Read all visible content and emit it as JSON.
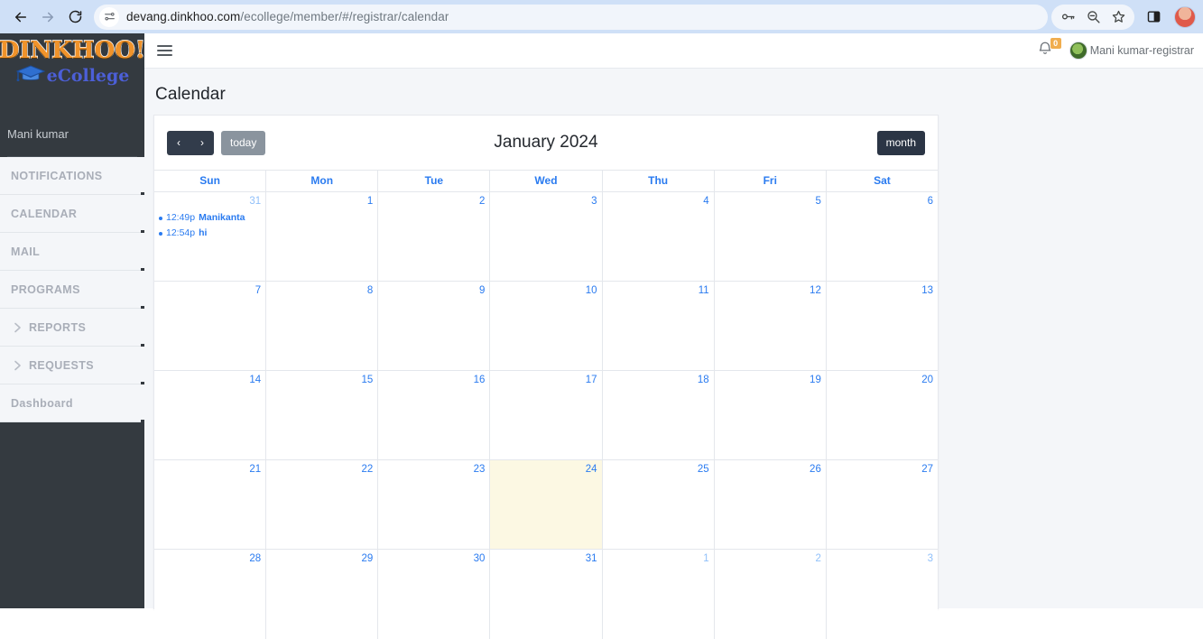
{
  "browser": {
    "url_main": "devang.dinkhoo.com",
    "url_path": "/ecollege/member/#/registrar/calendar",
    "back_icon": "back-arrow-icon",
    "forward_icon": "forward-arrow-icon",
    "reload_icon": "reload-icon",
    "site_info_icon": "site-settings-icon",
    "password_icon": "password-key-icon",
    "zoom_icon": "zoom-out-icon",
    "bookmark_icon": "bookmark-star-icon",
    "sidepanel_icon": "side-panel-icon",
    "profile_icon": "browser-profile-avatar"
  },
  "sidebar": {
    "logo_word": "DINKHOO!",
    "logo_sub": "eCollege",
    "user_name": "Mani kumar",
    "items": [
      {
        "label": "NOTIFICATIONS",
        "expandable": false
      },
      {
        "label": "CALENDAR",
        "expandable": false
      },
      {
        "label": "MAIL",
        "expandable": false
      },
      {
        "label": "PROGRAMS",
        "expandable": false
      },
      {
        "label": "REPORTS",
        "expandable": true
      },
      {
        "label": "REQUESTS",
        "expandable": true
      },
      {
        "label": "Dashboard",
        "expandable": false
      }
    ]
  },
  "topbar": {
    "menu_toggle": "hamburger-menu-icon",
    "bell_icon": "notification-bell-icon",
    "bell_badge": "0",
    "user_label": "Mani kumar-registrar"
  },
  "page": {
    "title": "Calendar"
  },
  "calendar": {
    "title": "January 2024",
    "prev_label": "‹",
    "next_label": "›",
    "today_label": "today",
    "view_label": "month",
    "weekdays": [
      "Sun",
      "Mon",
      "Tue",
      "Wed",
      "Thu",
      "Fri",
      "Sat"
    ],
    "today_date": 24,
    "weeks": [
      [
        {
          "day": "31",
          "other": true,
          "today": false,
          "events": [
            {
              "time": "12:49p",
              "title": "Manikanta"
            },
            {
              "time": "12:54p",
              "title": "hi"
            }
          ]
        },
        {
          "day": "1",
          "other": false,
          "today": false,
          "events": []
        },
        {
          "day": "2",
          "other": false,
          "today": false,
          "events": []
        },
        {
          "day": "3",
          "other": false,
          "today": false,
          "events": []
        },
        {
          "day": "4",
          "other": false,
          "today": false,
          "events": []
        },
        {
          "day": "5",
          "other": false,
          "today": false,
          "events": []
        },
        {
          "day": "6",
          "other": false,
          "today": false,
          "events": []
        }
      ],
      [
        {
          "day": "7",
          "other": false,
          "today": false,
          "events": []
        },
        {
          "day": "8",
          "other": false,
          "today": false,
          "events": []
        },
        {
          "day": "9",
          "other": false,
          "today": false,
          "events": []
        },
        {
          "day": "10",
          "other": false,
          "today": false,
          "events": []
        },
        {
          "day": "11",
          "other": false,
          "today": false,
          "events": []
        },
        {
          "day": "12",
          "other": false,
          "today": false,
          "events": []
        },
        {
          "day": "13",
          "other": false,
          "today": false,
          "events": []
        }
      ],
      [
        {
          "day": "14",
          "other": false,
          "today": false,
          "events": []
        },
        {
          "day": "15",
          "other": false,
          "today": false,
          "events": []
        },
        {
          "day": "16",
          "other": false,
          "today": false,
          "events": []
        },
        {
          "day": "17",
          "other": false,
          "today": false,
          "events": []
        },
        {
          "day": "18",
          "other": false,
          "today": false,
          "events": []
        },
        {
          "day": "19",
          "other": false,
          "today": false,
          "events": []
        },
        {
          "day": "20",
          "other": false,
          "today": false,
          "events": []
        }
      ],
      [
        {
          "day": "21",
          "other": false,
          "today": false,
          "events": []
        },
        {
          "day": "22",
          "other": false,
          "today": false,
          "events": []
        },
        {
          "day": "23",
          "other": false,
          "today": false,
          "events": []
        },
        {
          "day": "24",
          "other": false,
          "today": true,
          "events": []
        },
        {
          "day": "25",
          "other": false,
          "today": false,
          "events": []
        },
        {
          "day": "26",
          "other": false,
          "today": false,
          "events": []
        },
        {
          "day": "27",
          "other": false,
          "today": false,
          "events": []
        }
      ],
      [
        {
          "day": "28",
          "other": false,
          "today": false,
          "events": []
        },
        {
          "day": "29",
          "other": false,
          "today": false,
          "events": []
        },
        {
          "day": "30",
          "other": false,
          "today": false,
          "events": []
        },
        {
          "day": "31",
          "other": false,
          "today": false,
          "events": []
        },
        {
          "day": "1",
          "other": true,
          "today": false,
          "events": []
        },
        {
          "day": "2",
          "other": true,
          "today": false,
          "events": []
        },
        {
          "day": "3",
          "other": true,
          "today": false,
          "events": []
        }
      ]
    ]
  },
  "colors": {
    "sidebar_dark": "#343a40",
    "accent_blue": "#2a7bf0",
    "today_bg": "#fcf8e3",
    "btn_dark": "#323c4b",
    "logo_orange": "#f0932b",
    "badge_orange": "#f0ad4e"
  }
}
